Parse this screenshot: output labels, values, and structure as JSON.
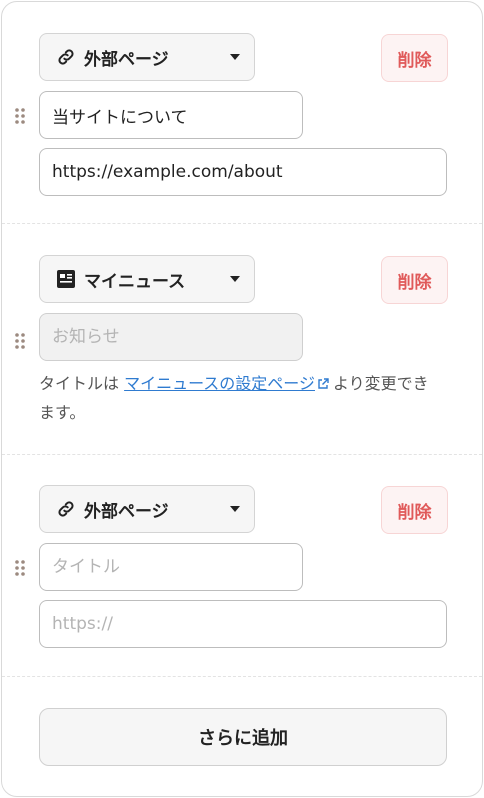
{
  "items": [
    {
      "type_label": "外部ページ",
      "type_icon": "link-icon",
      "delete_label": "削除",
      "title_value": "当サイトについて",
      "url_value": "https://example.com/about"
    },
    {
      "type_label": "マイニュース",
      "type_icon": "news-icon",
      "delete_label": "削除",
      "title_placeholder": "お知らせ",
      "help_prefix": "タイトルは ",
      "help_link": "マイニュースの設定ページ",
      "help_suffix": "より変更でき",
      "help_suffix_line2": "ます。"
    },
    {
      "type_label": "外部ページ",
      "type_icon": "link-icon",
      "delete_label": "削除",
      "title_placeholder": "タイトル",
      "url_placeholder": "https://"
    }
  ],
  "add_more_label": "さらに追加",
  "colors": {
    "delete_text": "#e05a5a",
    "delete_bg": "#fdf3f3",
    "link": "#2f7bd0",
    "drag_dot": "#9c8a80"
  }
}
